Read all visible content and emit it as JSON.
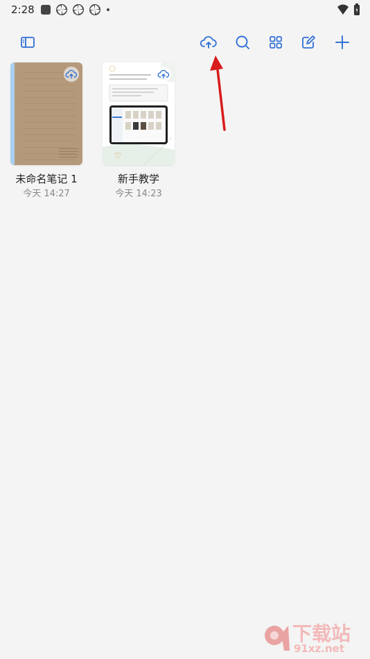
{
  "status": {
    "time": "2:28"
  },
  "toolbar": {
    "sidebar_icon": "sidebar-toggle-icon",
    "actions": [
      "cloud-sync-icon",
      "search-icon",
      "grid-view-icon",
      "edit-icon",
      "add-icon"
    ],
    "accent": "#2f6fd6"
  },
  "notes": [
    {
      "title": "未命名笔记 1",
      "time": "今天 14:27",
      "cover": "kraft-notebook"
    },
    {
      "title": "新手教学",
      "time": "今天 14:23",
      "cover": "tutorial-preview"
    }
  ],
  "annotation_color": "#d81b1b",
  "watermark": {
    "text": "下载站",
    "url": "91xz.net"
  }
}
